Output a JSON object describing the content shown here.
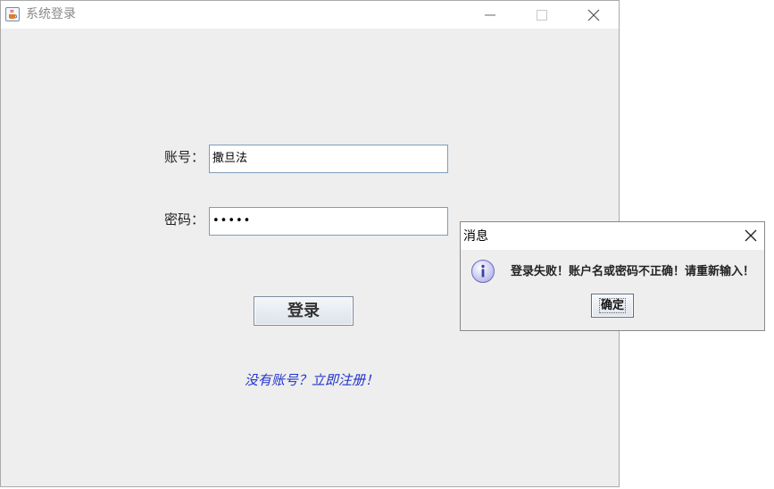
{
  "window": {
    "title": "系统登录",
    "icon": "java-coffee-icon"
  },
  "form": {
    "account_label": "账号：",
    "account_value": "撒旦法",
    "password_label": "密码：",
    "password_value": "•••••",
    "login_button": "登录",
    "register_link": "没有账号？立即注册！"
  },
  "dialog": {
    "title": "消息",
    "icon": "info-icon",
    "message": "登录失败！账户名或密码不正确！请重新输入！",
    "ok_button": "确定"
  },
  "colors": {
    "window_bg": "#eeeeee",
    "link": "#2233cc",
    "field_border": "#7f9db9"
  }
}
